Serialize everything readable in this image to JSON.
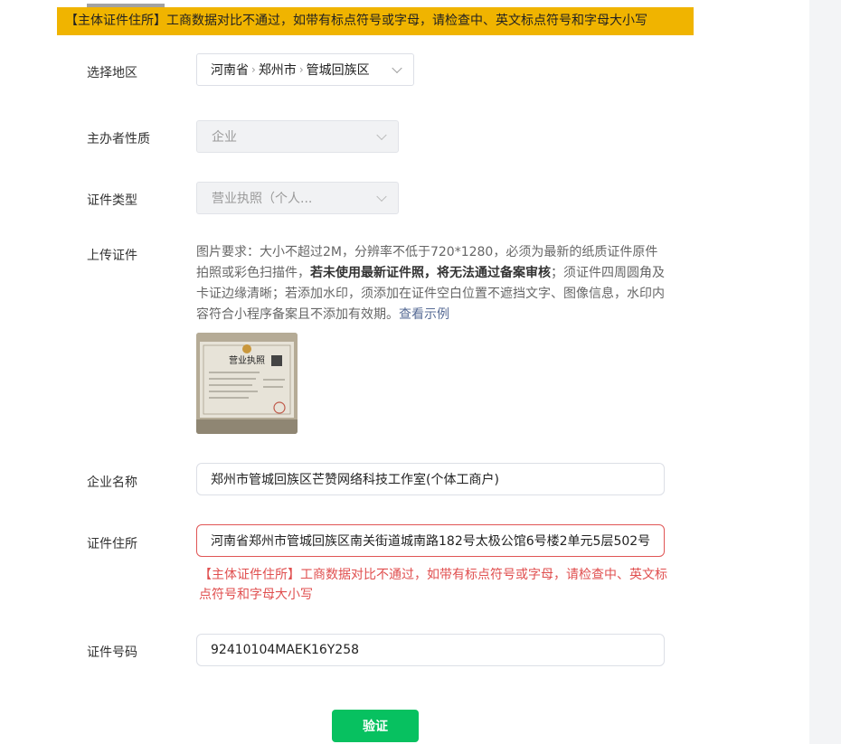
{
  "banner": {
    "text": "【主体证件住所】工商数据对比不通过，如带有标点符号或字母，请检查中、英文标点符号和字母大小写",
    "color": "#f0b400"
  },
  "form": {
    "region": {
      "label": "选择地区",
      "province": "河南省",
      "city": "郑州市",
      "district": "管城回族区",
      "icon": "chevron-down-icon"
    },
    "organizer_type": {
      "label": "主办者性质",
      "value": "企业"
    },
    "cert_type": {
      "label": "证件类型",
      "value": "营业执照（个人..."
    },
    "upload": {
      "label": "上传证件",
      "req_part1": "图片要求：大小不超过2M，分辨率不低于720*1280，必须为最新的纸质证件原件拍照或彩色扫描件，",
      "req_bold": "若未使用最新证件照，将无法通过备案审核",
      "req_part2": "；须证件四周圆角及卡证边缘清晰；若添加水印，须添加在证件空白位置不遮挡文字、图像信息，水印内容符合小程序备案且不添加有效期。",
      "example_link": "查看示例",
      "thumb_title": "营业执照"
    },
    "company_name": {
      "label": "企业名称",
      "value": "郑州市管城回族区芒赞网络科技工作室(个体工商户)"
    },
    "cert_address": {
      "label": "证件住所",
      "value": "河南省郑州市管城回族区南关街道城南路182号太极公馆6号楼2单元5层502号",
      "error": "【主体证件住所】工商数据对比不通过，如带有标点符号或字母，请检查中、英文标点符号和字母大小写",
      "error_color": "#e04f4f"
    },
    "cert_number": {
      "label": "证件号码",
      "value": "92410104MAEK16Y258"
    },
    "verify_button": {
      "label": "验证",
      "color": "#07c160"
    }
  }
}
